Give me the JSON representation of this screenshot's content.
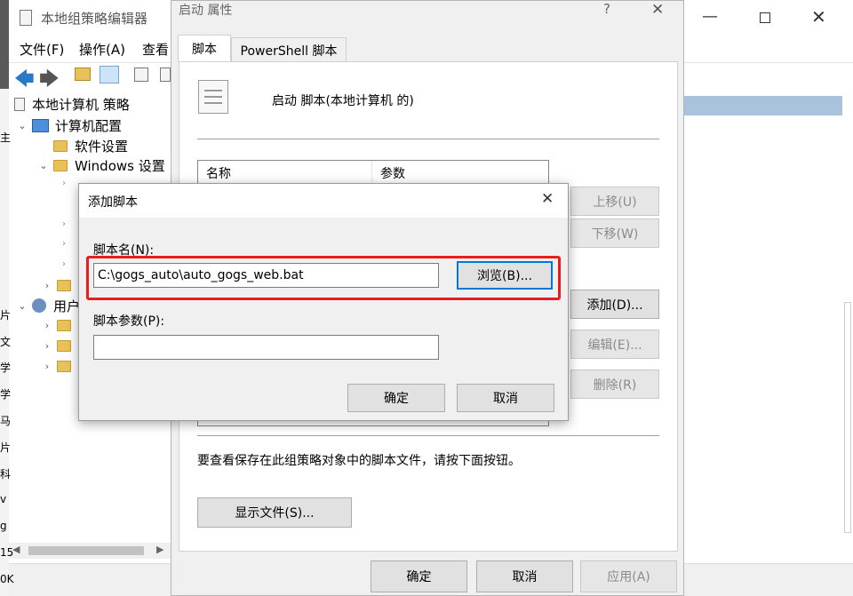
{
  "gpedit": {
    "title": "本地组策略编辑器",
    "menu": [
      "文件(F)",
      "操作(A)",
      "查看"
    ],
    "tree": {
      "root": "本地计算机 策略",
      "computer_config": "计算机配置",
      "software_settings": "软件设置",
      "windows_settings": "Windows 设置",
      "user_config": "用户"
    },
    "left_edge_chars": [
      "主",
      "片",
      "文",
      "学",
      "学",
      "马",
      "片",
      "科",
      "v",
      "g",
      "15",
      "0K"
    ]
  },
  "startup_props": {
    "title": "启动 属性",
    "help": "?",
    "tabs": [
      "脚本",
      "PowerShell 脚本"
    ],
    "heading": "启动 脚本(本地计算机 的)",
    "table_headers": [
      "名称",
      "参数"
    ],
    "buttons": {
      "up": "上移(U)",
      "down": "下移(W)",
      "add": "添加(D)...",
      "edit": "编辑(E)...",
      "remove": "删除(R)",
      "show_files": "显示文件(S)...",
      "ok": "确定",
      "cancel": "取消",
      "apply": "应用(A)"
    },
    "info_text": "要查看保存在此组策略对象中的脚本文件，请按下面按钮。"
  },
  "add_script": {
    "title": "添加脚本",
    "name_label": "脚本名(N):",
    "name_value": "C:\\gogs_auto\\auto_gogs_web.bat",
    "browse": "浏览(B)...",
    "params_label": "脚本参数(P):",
    "params_value": "",
    "ok": "确定",
    "cancel": "取消",
    "highlight_color": "#e81e1e"
  }
}
